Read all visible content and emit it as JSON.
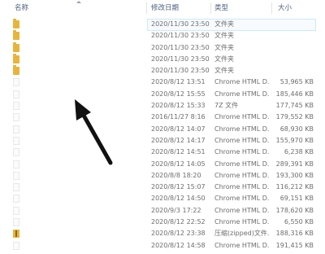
{
  "columns": {
    "name": "名称",
    "modified": "修改日期",
    "type": "类型",
    "size": "大小"
  },
  "rows": [
    {
      "icon": "folder",
      "date": "2020/11/30 23:50",
      "type": "文件夹",
      "size": "",
      "selected": true
    },
    {
      "icon": "folder",
      "date": "2020/11/30 23:50",
      "type": "文件夹",
      "size": ""
    },
    {
      "icon": "folder",
      "date": "2020/11/30 23:50",
      "type": "文件夹",
      "size": ""
    },
    {
      "icon": "folder",
      "date": "2020/11/30 23:50",
      "type": "文件夹",
      "size": ""
    },
    {
      "icon": "folder",
      "date": "2020/11/30 23:50",
      "type": "文件夹",
      "size": ""
    },
    {
      "icon": "file",
      "date": "2020/8/12 13:51",
      "type": "Chrome HTML D...",
      "size": "53,965 KB"
    },
    {
      "icon": "file",
      "date": "2020/8/12 15:55",
      "type": "Chrome HTML D...",
      "size": "185,446 KB"
    },
    {
      "icon": "file",
      "date": "2020/8/12 15:33",
      "type": "7Z 文件",
      "size": "177,745 KB"
    },
    {
      "icon": "file",
      "date": "2016/11/27 8:16",
      "type": "Chrome HTML D...",
      "size": "179,552 KB"
    },
    {
      "icon": "file",
      "date": "2020/8/12 14:07",
      "type": "Chrome HTML D...",
      "size": "68,930 KB"
    },
    {
      "icon": "file",
      "date": "2020/8/12 14:17",
      "type": "Chrome HTML D...",
      "size": "155,970 KB"
    },
    {
      "icon": "file",
      "date": "2020/8/12 14:51",
      "type": "Chrome HTML D...",
      "size": "6,238 KB"
    },
    {
      "icon": "file",
      "date": "2020/8/12 14:05",
      "type": "Chrome HTML D...",
      "size": "289,391 KB"
    },
    {
      "icon": "file",
      "date": "2020/8/8 18:20",
      "type": "Chrome HTML D...",
      "size": "193,300 KB"
    },
    {
      "icon": "file",
      "date": "2020/8/12 15:07",
      "type": "Chrome HTML D...",
      "size": "116,212 KB"
    },
    {
      "icon": "file",
      "date": "2020/8/12 14:50",
      "type": "Chrome HTML D...",
      "size": "69,151 KB"
    },
    {
      "icon": "file",
      "date": "2020/9/3 17:22",
      "type": "Chrome HTML D...",
      "size": "178,620 KB"
    },
    {
      "icon": "file",
      "date": "2020/8/12 22:52",
      "type": "Chrome HTML D...",
      "size": "6,550 KB"
    },
    {
      "icon": "zipfolder",
      "date": "2020/8/12 23:38",
      "type": "压缩(zipped)文件...",
      "size": "188,316 KB"
    },
    {
      "icon": "file",
      "date": "2020/8/12 14:58",
      "type": "Chrome HTML D...",
      "size": "191,415 KB"
    }
  ],
  "colors": {
    "header_text": "#4d6082",
    "folder": "#e8b43a",
    "selection_border": "#cde8ff",
    "arrow": "#111111"
  }
}
